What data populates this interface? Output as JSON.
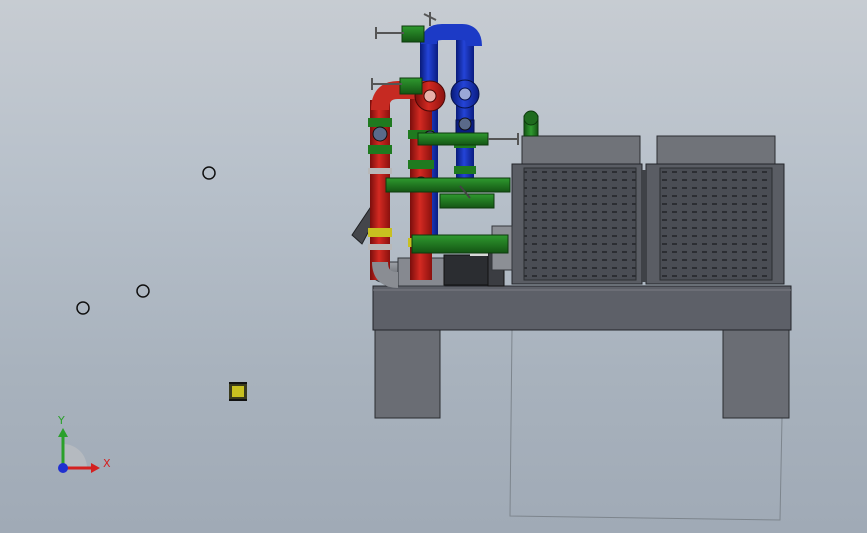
{
  "app": {
    "kind": "3D CAD model viewport",
    "background_top": "#c7ccd2",
    "background_bottom": "#a0aab6"
  },
  "triad": {
    "y_label": "Y",
    "x_label": "X",
    "y_color": "#2aa02a",
    "x_color": "#d42020",
    "z_color": "#2030d0"
  },
  "model": {
    "description_colors": {
      "hot_pipe": "#c41e1a",
      "cold_pipe": "#1230b8",
      "valve_green": "#1f7a1f",
      "flange_yellow": "#c8c020",
      "frame_grey": "#5d6068",
      "leg_grey": "#6a6d74",
      "grille_dark": "#43464d"
    }
  }
}
